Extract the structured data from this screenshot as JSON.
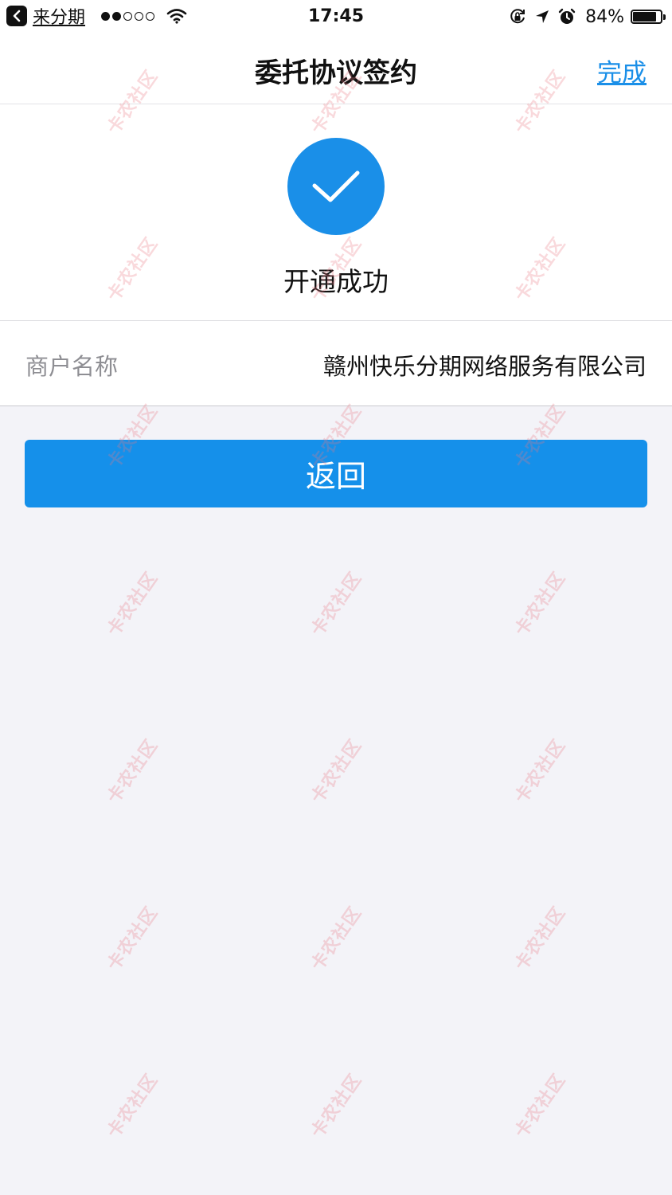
{
  "status_bar": {
    "back_app": "来分期",
    "time": "17:45",
    "battery_percent": "84%",
    "battery_level": 0.84,
    "signal_bars_filled": 2,
    "signal_bars_total": 5
  },
  "nav": {
    "title": "委托协议签约",
    "done_label": "完成"
  },
  "success": {
    "message": "开通成功"
  },
  "merchant": {
    "label": "商户名称",
    "value": "赣州快乐分期网络服务有限公司"
  },
  "actions": {
    "return_label": "返回"
  },
  "watermark": {
    "text": "卡农社区"
  },
  "colors": {
    "accent": "#1a8fe8",
    "background": "#f3f3f8"
  }
}
